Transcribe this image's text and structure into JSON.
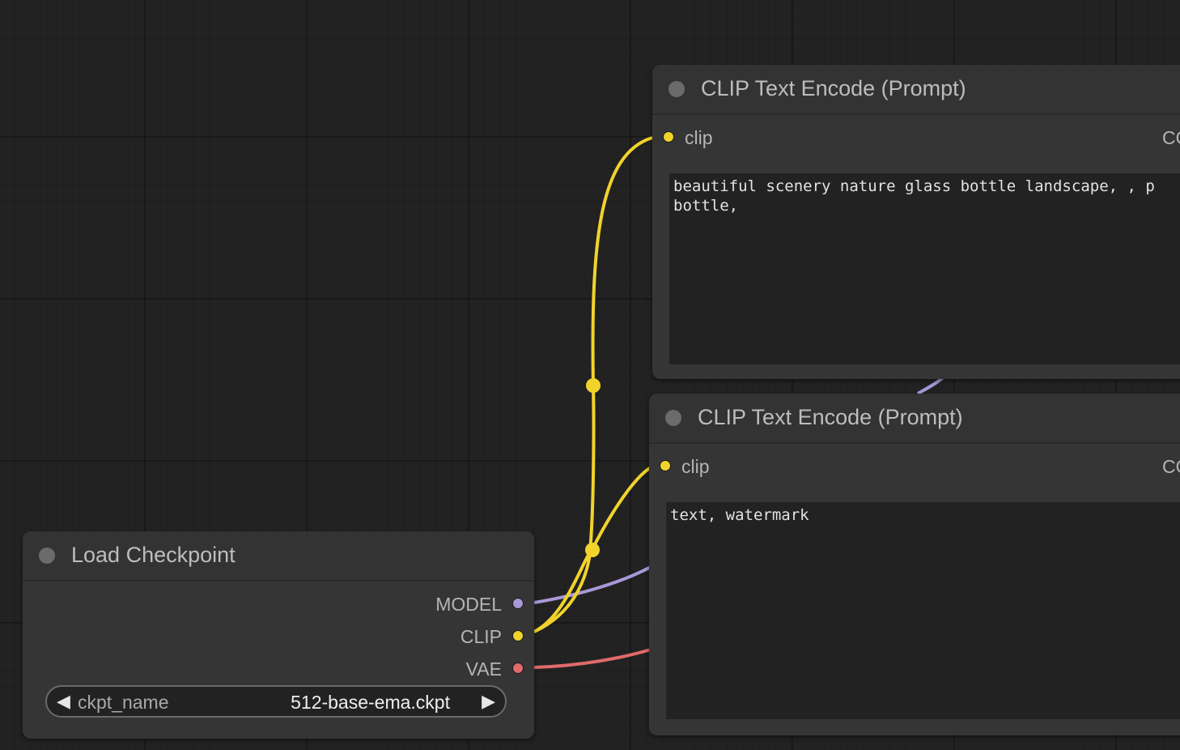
{
  "colors": {
    "canvas_bg": "#222222",
    "node_bg": "#353535",
    "model_link": "#a898d8",
    "clip_link": "#f1d32c",
    "vae_link": "#e06a6a",
    "node_status_dot": "#6b6b6b"
  },
  "nodes": {
    "clip_positive": {
      "title": "CLIP Text Encode (Prompt)",
      "input_label": "clip",
      "output_label_partial": "CO",
      "text": "beautiful scenery nature glass bottle landscape, , p\nbottle,"
    },
    "clip_negative": {
      "title": "CLIP Text Encode (Prompt)",
      "input_label": "clip",
      "output_label_partial": "CO",
      "text": "text, watermark"
    },
    "load_checkpoint": {
      "title": "Load Checkpoint",
      "outputs": {
        "model": "MODEL",
        "clip": "CLIP",
        "vae": "VAE"
      },
      "widget": {
        "name": "ckpt_name",
        "value": "512-base-ema.ckpt",
        "left_arrow_icon": "triangle-left-icon",
        "right_arrow_icon": "triangle-right-icon"
      }
    }
  }
}
